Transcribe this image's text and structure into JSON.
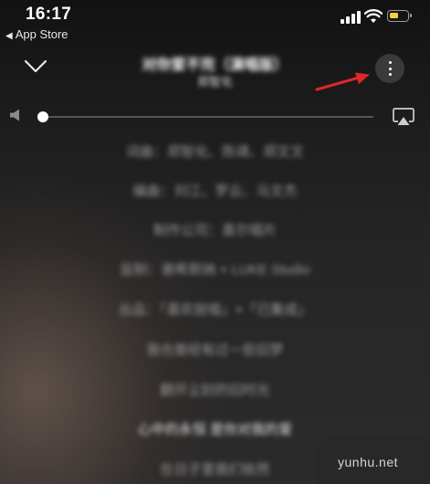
{
  "status_bar": {
    "time": "16:17",
    "back_label": "App Store",
    "battery_color": "#f4d03f"
  },
  "player": {
    "song_title": "对你爱不完（演唱版）",
    "artist": "郑智化",
    "more_icon": "more-vertical-icon",
    "collapse_icon": "chevron-down-icon",
    "airplay_icon": "airplay-icon",
    "volume_icon": "speaker-icon",
    "volume_level": 0.0
  },
  "credits": [
    "词曲：郑智化、陈靖、郑文文",
    "编曲：刘江、罗云、马文杰",
    "制作公司：喜尔唱片",
    "监制：谢希默纳 × LUKE Studio",
    "出品：「喜欢就唱」×「已集成」",
    "我也曾经有过一些旧梦",
    "翻开尘封的旧时光",
    "心中的永恒 是你对我的爱",
    "在日子里我们依然"
  ],
  "watermark": "yunhu.net",
  "annotation_color": "#e0262a"
}
